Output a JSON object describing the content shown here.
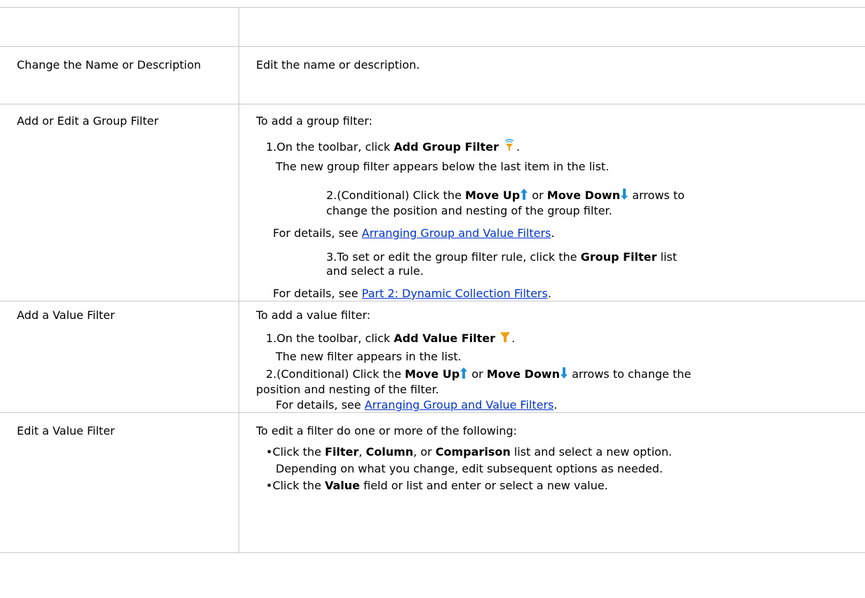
{
  "rows": [
    {
      "action": "",
      "description": ""
    },
    {
      "action": "Change the Name or Description",
      "description": "Edit the name or description."
    },
    {
      "action": "Add or Edit a Group Filter",
      "intro": "To add a group filter:",
      "step1": {
        "prefix": "1.On the toolbar, click ",
        "bold": "Add Group Filter",
        "suffix": "."
      },
      "step1_note": "The new group filter appears below the last item in the list.",
      "step2": {
        "prefix": "2.(Conditional) Click the ",
        "bold1": "Move Up",
        "mid": " or ",
        "bold2": "Move Down",
        "suffix_line1": " arrows to",
        "line2": "change the position and nesting of the group filter."
      },
      "details1": {
        "prefix": "For details, see ",
        "link": "Arranging Group and Value Filters",
        "suffix": "."
      },
      "step3": {
        "prefix": "3.To set or edit the group filter rule, click the ",
        "bold": "Group Filter",
        "suffix": " list",
        "line2": "and select a rule."
      },
      "details2": {
        "prefix": "For details, see ",
        "link": "Part 2: Dynamic Collection Filters",
        "suffix": "."
      }
    },
    {
      "action": "Add a Value Filter",
      "intro": "To add a value filter:",
      "step1": {
        "prefix": "1.On the toolbar, click ",
        "bold": "Add Value Filter",
        "suffix": "."
      },
      "step1_note": "The new filter appears in the list.",
      "step2": {
        "prefix": "2.(Conditional) Click the ",
        "bold1": "Move Up",
        "mid": " or ",
        "bold2": "Move Down",
        "suffix_line1": " arrows to change the",
        "line2": "position and nesting of the filter."
      },
      "details": {
        "prefix": "For details, see ",
        "link": "Arranging Group and Value Filters",
        "suffix": "."
      }
    },
    {
      "action": "Edit a Value Filter",
      "intro": "To edit a filter do one or more of the following:",
      "bullet1": {
        "prefix": "•Click the ",
        "b1": "Filter",
        "s1": ", ",
        "b2": "Column",
        "s2": ", or ",
        "b3": "Comparison",
        "suffix": " list and select a new option."
      },
      "bullet1_note": "Depending on what you change, edit subsequent options as needed.",
      "bullet2": {
        "prefix": "•Click the ",
        "bold": "Value",
        "suffix": " field or list and enter or select a new value."
      }
    }
  ],
  "icons": {
    "group_filter": "group-filter-icon",
    "value_filter": "value-filter-icon",
    "move_up": "arrow-up-icon",
    "move_down": "arrow-down-icon"
  },
  "colors": {
    "link": "#0033cc",
    "arrow": "#1e90d8",
    "funnel": "#f0a010",
    "border": "#c8c8c8"
  }
}
